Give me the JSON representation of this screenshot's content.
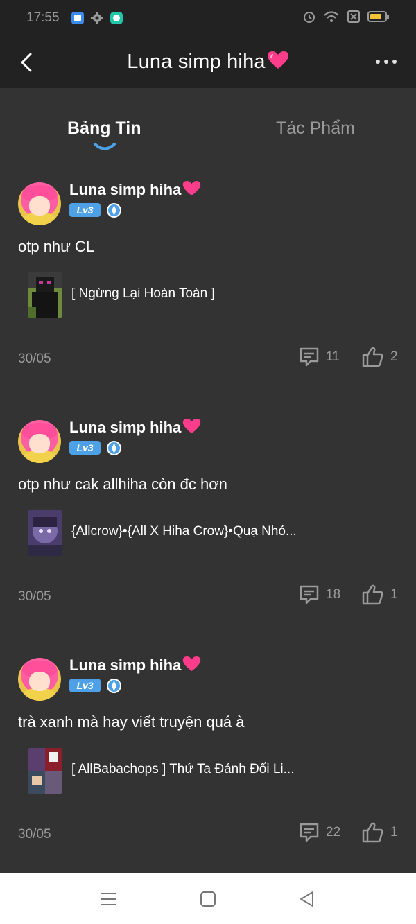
{
  "status_bar": {
    "time": "17:55",
    "left_icons": [
      "app-blue-icon",
      "gear-icon",
      "chat-bubble-icon"
    ],
    "right_icons": [
      "alarm-icon",
      "wifi-icon",
      "sim-off-icon",
      "battery-icon"
    ]
  },
  "header": {
    "title": "Luna simp hiha",
    "back_icon": "chevron-left-icon",
    "more_icon": "more-dots-icon"
  },
  "tabs": [
    {
      "label": "Bảng Tin",
      "active": true
    },
    {
      "label": "Tác Phẩm",
      "active": false
    }
  ],
  "posts": [
    {
      "author": "Luna simp hiha",
      "level": "Lv3",
      "content": "otp như CL",
      "work_title": "[ Ngừng Lại Hoàn Toàn ]",
      "date": "30/05",
      "comments": "11",
      "likes": "2"
    },
    {
      "author": "Luna simp hiha",
      "level": "Lv3",
      "content": "otp như cak allhiha còn đc hơn",
      "work_title": "{Allcrow}•{All X Hiha Crow}•Quạ Nhỏ...",
      "date": "30/05",
      "comments": "18",
      "likes": "1"
    },
    {
      "author": "Luna simp hiha",
      "level": "Lv3",
      "content": "trà xanh mà hay viết truyện quá à",
      "work_title": "[ AllBabachops ] Thứ Ta Đánh Đổi Li...",
      "date": "30/05",
      "comments": "22",
      "likes": "1"
    }
  ],
  "nav_bar": {
    "buttons": [
      "menu-icon",
      "home-square-icon",
      "back-triangle-icon"
    ]
  },
  "colors": {
    "background": "#333333",
    "bars": "#222222",
    "accent": "#4ea1e6",
    "heart": "#ff3d8b",
    "muted_text": "#9a9a9a"
  }
}
